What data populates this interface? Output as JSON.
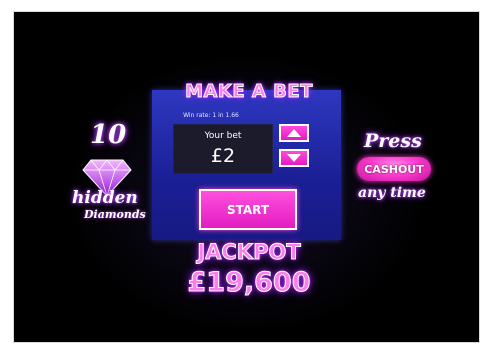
{
  "game": {
    "title": "MAKE A BET",
    "win_rate": "Win rate: 1 in 1.66",
    "bet": {
      "label": "Your bet",
      "value": "£2"
    },
    "controls": {
      "increase_icon": "arrow-up-icon",
      "decrease_icon": "arrow-down-icon"
    },
    "start_label": "START",
    "jackpot": {
      "label": "JACKPOT",
      "value": "£19,600"
    }
  },
  "hidden_badge": {
    "count": "10",
    "line1": "hidden",
    "line2": "Diamonds",
    "icon": "diamond-icon"
  },
  "press_badge": {
    "line1": "Press",
    "button": "CASHOUT",
    "line2": "any time"
  },
  "colors": {
    "background": "#000000",
    "panel": "#1f239c",
    "accent_pink": "#ff3bd0",
    "glow_purple": "#8a2be2"
  }
}
